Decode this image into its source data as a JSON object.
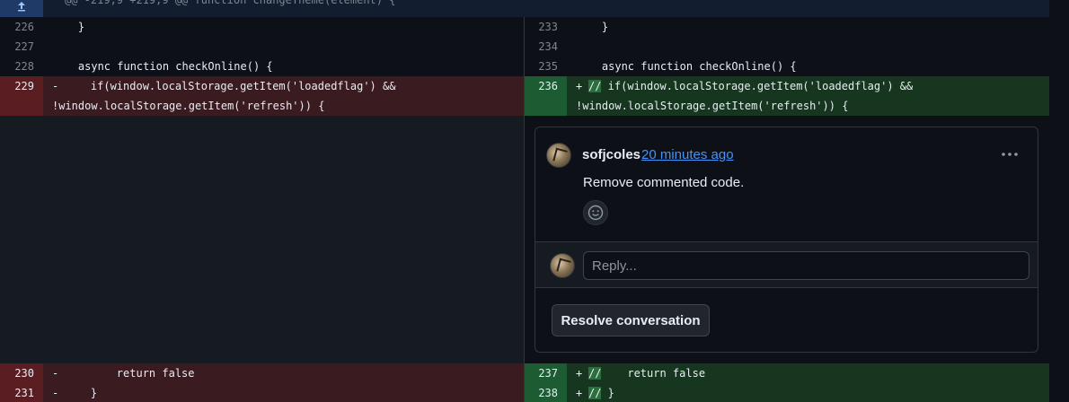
{
  "hunk": {
    "header": "@@ -219,9 +219,9 @@ function changeTheme(element) {"
  },
  "lines": [
    {
      "left_num": "226",
      "left_code": "    }",
      "right_num": "233",
      "right_code": "    }",
      "type": "context"
    },
    {
      "left_num": "227",
      "left_code": "",
      "right_num": "234",
      "right_code": "",
      "type": "context"
    },
    {
      "left_num": "228",
      "left_code": "    async function checkOnline() {",
      "right_num": "235",
      "right_code": "    async function checkOnline() {",
      "type": "context"
    }
  ],
  "changed_1": {
    "left_num": "229",
    "left_sign": "-",
    "left_code_a": "    if(window.localStorage.getItem('loadedflag') &&",
    "left_code_b": "!window.localStorage.getItem('refresh')) {",
    "right_num": "236",
    "right_sign": "+",
    "right_comment_mark": "//",
    "right_code_a": " if(window.localStorage.getItem('loadedflag') &&",
    "right_code_b": "!window.localStorage.getItem('refresh')) {"
  },
  "changed_2": [
    {
      "left_num": "230",
      "left_sign": "-",
      "left_code": "        return false",
      "right_num": "237",
      "right_sign": "+",
      "right_comment_mark": "//",
      "right_code": "    return false"
    },
    {
      "left_num": "231",
      "left_sign": "-",
      "left_code": "    }",
      "right_num": "238",
      "right_sign": "+",
      "right_comment_mark": "//",
      "right_code": " }"
    }
  ],
  "comment": {
    "author": "sofjcoles",
    "timestamp": "20 minutes ago",
    "body": "Remove commented code.",
    "more_icon": "kebab-horizontal-icon",
    "reaction_icon": "smiley-icon"
  },
  "reply": {
    "placeholder": "Reply..."
  },
  "resolve": {
    "label": "Resolve conversation"
  },
  "colors": {
    "deletion": "#3a1c20",
    "addition": "#17361f",
    "link": "#4493f8",
    "hunk": "#1f3a67"
  }
}
